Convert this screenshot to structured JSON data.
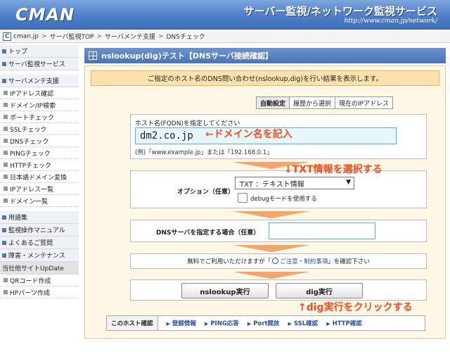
{
  "header": {
    "logo": "CMAN",
    "title": "サーバー監視/ネットワーク監視サービス",
    "url": "http://www.cman.jp/network/"
  },
  "breadcrumb": {
    "icon_letter": "C",
    "items": [
      "cman.jp",
      "サーバ監視TOP",
      "サーバメンテ支援",
      "DNSチェック"
    ],
    "separator": ">"
  },
  "sidebar": {
    "items": [
      {
        "label": "トップ",
        "kind": "top"
      },
      {
        "label": "サーバ監視サービス",
        "kind": "top"
      },
      {
        "label": "サーバメンテ支援",
        "kind": "top"
      },
      {
        "label": "IPアドレス確認",
        "kind": "sub"
      },
      {
        "label": "ドメイン/IP検索",
        "kind": "sub"
      },
      {
        "label": "ポートチェック",
        "kind": "sub"
      },
      {
        "label": "SSLチェック",
        "kind": "sub"
      },
      {
        "label": "DNSチェック",
        "kind": "sub"
      },
      {
        "label": "PINGチェック",
        "kind": "sub"
      },
      {
        "label": "HTTPチェック",
        "kind": "sub"
      },
      {
        "label": "日本語ドメイン変換",
        "kind": "sub"
      },
      {
        "label": "IPアドレス一覧",
        "kind": "sub"
      },
      {
        "label": "ドメイン一覧",
        "kind": "sub"
      },
      {
        "label": "用語集",
        "kind": "top"
      },
      {
        "label": "監視操作マニュアル",
        "kind": "top"
      },
      {
        "label": "よくあるご質問",
        "kind": "top"
      },
      {
        "label": "障害・メンテナンス",
        "kind": "top"
      },
      {
        "label": "当社他サイトUpDate",
        "kind": "header"
      },
      {
        "label": "QRコード作成",
        "kind": "sub"
      },
      {
        "label": "HPパーツ作成",
        "kind": "sub"
      }
    ]
  },
  "main": {
    "title": "nslookup(dig)テスト【DNSサーバ接続確認】",
    "intro": "ご指定のホスト名のDNS問い合わせ(nslookup,dig)を行い結果を表示します。",
    "tabs": [
      {
        "label": "自動設定",
        "active": true
      },
      {
        "label": "履歴から選択",
        "active": false
      },
      {
        "label": "現在のIPアドレス",
        "active": false
      }
    ],
    "fqdn": {
      "label": "ホスト名(FQDN)を指定してください",
      "value": "dm2.co.jp",
      "example": "(例)「www.example.jp」または「192.168.0.1」"
    },
    "option": {
      "label": "オプション（任意）",
      "selected": "TXT ：テキスト情報",
      "debug_label": "debugモードを使用する",
      "debug_checked": false
    },
    "dns_server": {
      "label": "DNSサーバを指定する場合（任意）",
      "value": ""
    },
    "notice": {
      "before": "無料でご利用いただけますが「",
      "link": "ご注意・制約事項",
      "after": "」を確認下さい"
    },
    "buttons": {
      "nslookup": "nslookup実行",
      "dig": "dig実行"
    },
    "quick": {
      "title": "このホスト確認",
      "links": [
        "登録情報",
        "PING応答",
        "Port開放",
        "SSL確認",
        "HTTP確認"
      ]
    }
  },
  "annotations": {
    "domain": "←ドメイン名を記入",
    "txt": "↓TXT情報を選択する",
    "dig": "↑dig実行をクリックする",
    "color": "#ff4a1a"
  }
}
